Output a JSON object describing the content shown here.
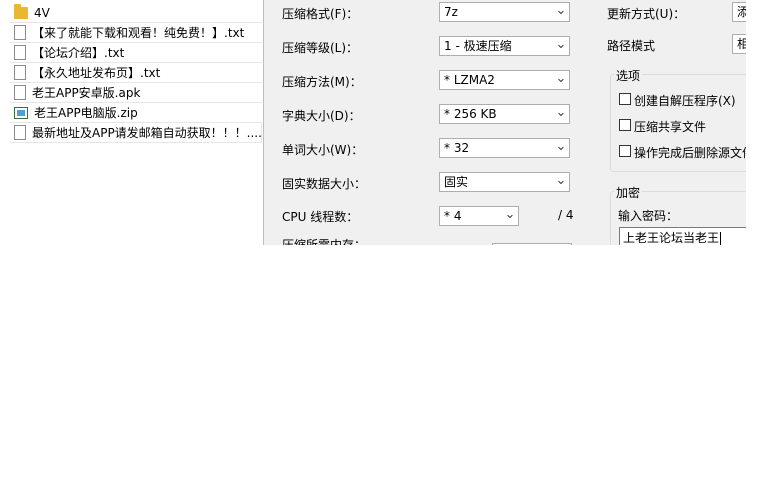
{
  "files": [
    {
      "name": "4V",
      "type": "folder"
    },
    {
      "name": "【来了就能下载和观看！纯免费！】.txt",
      "type": "doc"
    },
    {
      "name": "【论坛介绍】.txt",
      "type": "doc"
    },
    {
      "name": "【永久地址发布页】.txt",
      "type": "doc"
    },
    {
      "name": "老王APP安卓版.apk",
      "type": "doc"
    },
    {
      "name": "老王APP电脑版.zip",
      "type": "zip"
    },
    {
      "name": "最新地址及APP请发邮箱自动获取！！！....",
      "type": "doc"
    }
  ],
  "dialog": {
    "format_label": "压缩格式(F)：",
    "format_value": "7z",
    "level_label": "压缩等级(L)：",
    "level_value": "1 - 极速压缩",
    "method_label": "压缩方法(M)：",
    "method_value": "* LZMA2",
    "dict_label": "字典大小(D)：",
    "dict_value": "* 256 KB",
    "word_label": "单词大小(W)：",
    "word_value": "* 32",
    "solid_label": "固实数据大小：",
    "solid_value": "固实",
    "cpu_label": "CPU 线程数：",
    "cpu_value": "* 4",
    "cpu_total": "/ 4",
    "memory_label": "压缩所需内存：",
    "update_label": "更新方式(U)：",
    "update_value": "添",
    "path_label": "路径模式",
    "path_value": "相",
    "options_title": "选项",
    "opt_sfx": "创建自解压程序(X)",
    "opt_shared": "压缩共享文件",
    "opt_delete": "操作完成后删除源文件",
    "encrypt_title": "加密",
    "password_label": "输入密码：",
    "password_value": "上老王论坛当老王"
  }
}
